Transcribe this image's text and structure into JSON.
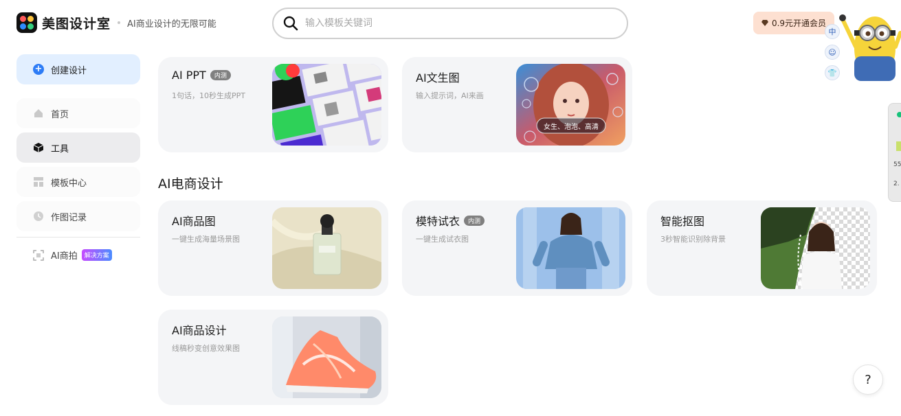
{
  "header": {
    "brand": "美图设计室",
    "slogan": "AI商业设计的无限可能",
    "search_placeholder": "输入模板关键词",
    "vip_label": "0.9元开通会员",
    "float_icons": [
      "中",
      "☺",
      "👕"
    ]
  },
  "sidebar": {
    "create_label": "创建设计",
    "items": [
      {
        "label": "首页",
        "icon": "home-icon"
      },
      {
        "label": "工具",
        "icon": "cube-icon"
      },
      {
        "label": "模板中心",
        "icon": "template-icon"
      },
      {
        "label": "作图记录",
        "icon": "clock-icon"
      }
    ],
    "ai_shoot_label": "AI商拍",
    "ai_shoot_badge": "解决方案"
  },
  "top_cards": [
    {
      "title": "AI PPT",
      "tag": "内测",
      "desc": "1句话，10秒生成PPT"
    },
    {
      "title": "AI文生图",
      "desc": "输入提示词，AI来画",
      "overlay": "女生、泡泡、高清"
    }
  ],
  "section": {
    "title": "AI电商设计"
  },
  "ecom_cards": [
    {
      "title": "AI商品图",
      "desc": "一键生成海量场景图"
    },
    {
      "title": "模特试衣",
      "tag": "内测",
      "desc": "一键生成试衣图"
    },
    {
      "title": "智能抠图",
      "desc": "3秒智能识别除背景"
    },
    {
      "title": "AI商品设计",
      "desc": "线稿秒变创意效果图"
    }
  ],
  "edge_widget": {
    "line1": "55",
    "line2": "2."
  },
  "help_label": "?",
  "colors": {
    "accent": "#2d7cf6",
    "vip_bg": "#fde0d1",
    "card_bg": "#f4f5f7"
  }
}
